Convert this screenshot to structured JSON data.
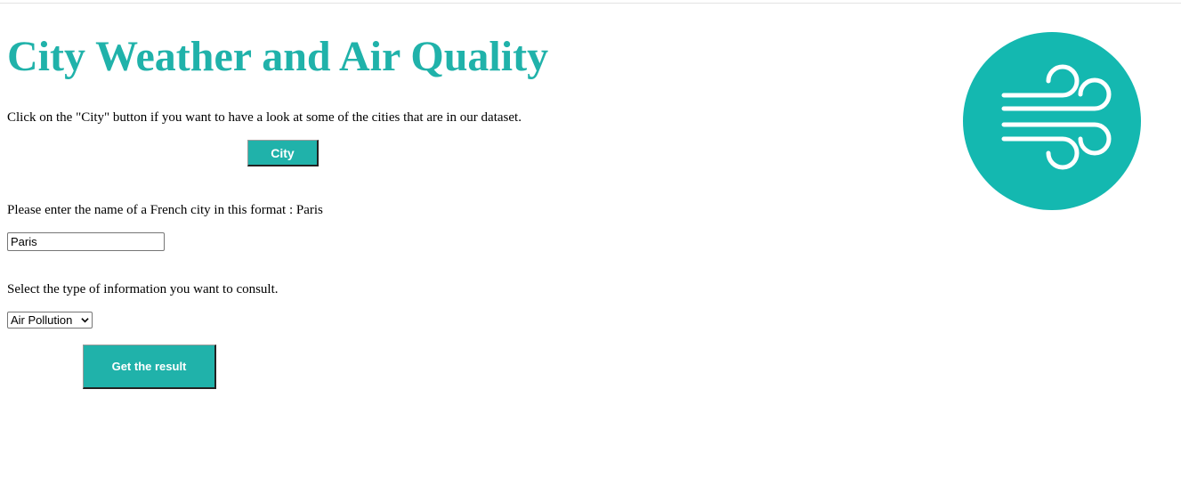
{
  "header": {
    "title": "City Weather and Air Quality"
  },
  "city_section": {
    "instruction": "Click on the \"City\" button if you want to have a look at some of the cities that are in our dataset.",
    "button_label": "City"
  },
  "city_input": {
    "label": "Please enter the name of a French city in this format : Paris",
    "value": "Paris"
  },
  "info_select": {
    "label": "Select the type of information you want to consult.",
    "selected": "Air Pollution"
  },
  "submit": {
    "label": "Get the result"
  },
  "logo": {
    "icon": "wind-icon",
    "color": "#14b8b0"
  },
  "colors": {
    "accent": "#20b2aa"
  }
}
